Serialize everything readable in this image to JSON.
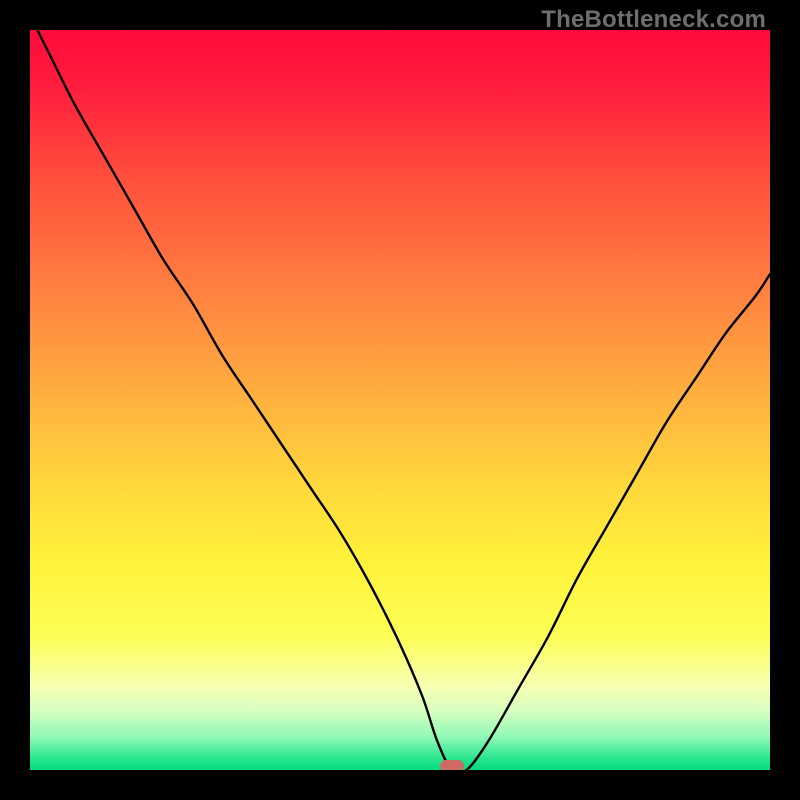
{
  "watermark": "TheBottleneck.com",
  "colors": {
    "frame": "#000000",
    "curve": "#000000",
    "marker": "#cf6a62",
    "gradient_stops": [
      {
        "offset": 0.0,
        "color": "#ff0a3a"
      },
      {
        "offset": 0.08,
        "color": "#ff1e3d"
      },
      {
        "offset": 0.2,
        "color": "#ff4f3c"
      },
      {
        "offset": 0.35,
        "color": "#ff8040"
      },
      {
        "offset": 0.5,
        "color": "#ffb23f"
      },
      {
        "offset": 0.62,
        "color": "#ffd93c"
      },
      {
        "offset": 0.72,
        "color": "#fff23a"
      },
      {
        "offset": 0.82,
        "color": "#fcff56"
      },
      {
        "offset": 0.885,
        "color": "#f8ffb0"
      },
      {
        "offset": 0.92,
        "color": "#d8ffc0"
      },
      {
        "offset": 0.955,
        "color": "#90f9b8"
      },
      {
        "offset": 0.985,
        "color": "#28e58e"
      },
      {
        "offset": 1.0,
        "color": "#05db80"
      }
    ]
  },
  "chart_data": {
    "type": "line",
    "title": "",
    "xlabel": "",
    "ylabel": "",
    "xlim": [
      0,
      100
    ],
    "ylim": [
      0,
      100
    ],
    "grid": false,
    "legend": false,
    "annotations": [
      {
        "name": "optimal-point",
        "x": 57,
        "y": 0
      }
    ],
    "series": [
      {
        "name": "bottleneck-curve",
        "x": [
          0,
          3,
          6,
          10,
          14,
          18,
          22,
          26,
          30,
          34,
          38,
          42,
          46,
          50,
          53,
          55,
          57,
          59,
          62,
          66,
          70,
          74,
          78,
          82,
          86,
          90,
          94,
          98,
          100
        ],
        "y": [
          102,
          96,
          90,
          83,
          76,
          69,
          63,
          56,
          50,
          44,
          38,
          32,
          25,
          17,
          10,
          4,
          0,
          0,
          4,
          11,
          18,
          26,
          33,
          40,
          47,
          53,
          59,
          64,
          67
        ]
      }
    ]
  }
}
